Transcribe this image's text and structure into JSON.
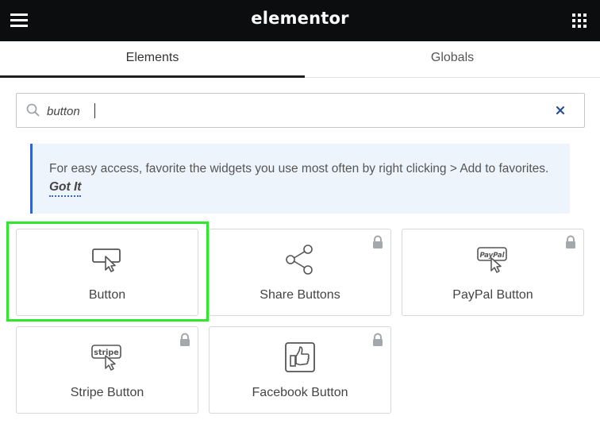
{
  "header": {
    "logo_text": "elementor",
    "menu_icon": "hamburger-menu-icon",
    "apps_icon": "grid-apps-icon"
  },
  "tabs": [
    {
      "label": "Elements",
      "active": true
    },
    {
      "label": "Globals",
      "active": false
    }
  ],
  "search": {
    "value": "button",
    "placeholder": "",
    "clear_icon": "close-icon"
  },
  "notice": {
    "text": "For easy access, favorite the widgets you use most often by right clicking > Add to favorites.",
    "link_label": "Got It"
  },
  "widgets": [
    {
      "label": "Button",
      "icon": "button-pointer-icon",
      "locked": false,
      "highlighted": true
    },
    {
      "label": "Share Buttons",
      "icon": "share-icon",
      "locked": true
    },
    {
      "label": "PayPal Button",
      "icon": "paypal-button-icon",
      "locked": true,
      "icon_text": "PayPal"
    },
    {
      "label": "Stripe Button",
      "icon": "stripe-button-icon",
      "locked": true,
      "icon_text": "stripe"
    },
    {
      "label": "Facebook Button",
      "icon": "facebook-like-icon",
      "locked": true
    }
  ],
  "colors": {
    "topbar": "#0c0d0e",
    "notice_bg": "#eef4fc",
    "notice_accent": "#3164d2",
    "highlight": "#2ee82e"
  }
}
